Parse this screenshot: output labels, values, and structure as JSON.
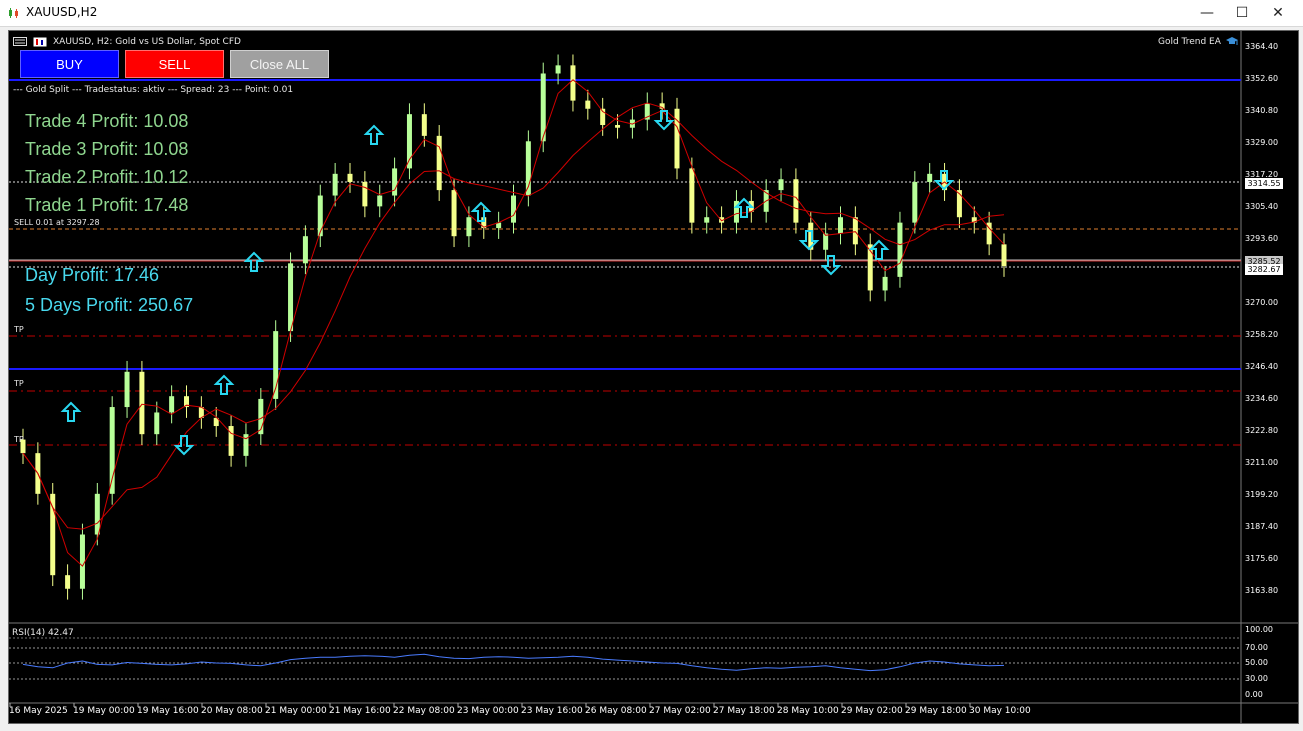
{
  "window": {
    "title": "XAUUSD,H2",
    "minimize": "—",
    "maximize": "☐",
    "close": "✕"
  },
  "chart_header": "XAUUSD, H2:  Gold vs US Dollar, Spot CFD",
  "ea_name": "Gold Trend EA",
  "buttons": {
    "buy": "BUY",
    "sell": "SELL",
    "close_all": "Close ALL"
  },
  "status_line": "--- Gold Split --- Tradestatus: aktiv --- Spread: 23 --- Point: 0.01",
  "trades": [
    "Trade 4 Profit: 10.08",
    "Trade 3 Profit: 10.08",
    "Trade 2 Profit: 10.12",
    "Trade 1 Profit: 17.48"
  ],
  "position_label": "SELL 0.01 at 3297.28",
  "day_profit": "Day Profit: 17.46",
  "five_day_profit": "5 Days Profit: 250.67",
  "tp_labels": [
    "TP",
    "TP",
    "TP"
  ],
  "price_axis": [
    "3364.40",
    "3352.60",
    "3340.80",
    "3329.00",
    "3317.20",
    "3305.40",
    "3293.60",
    "3282.67",
    "3270.00",
    "3258.20",
    "3246.40",
    "3234.60",
    "3222.80",
    "3211.00",
    "3199.20",
    "3187.40",
    "3175.60",
    "3163.80"
  ],
  "price_tags": {
    "level_1": "3314.55",
    "level_2": "3285.52",
    "last": "3282.67"
  },
  "rsi": {
    "label": "RSI(14) 42.47",
    "axis": [
      "100.00",
      "70.00",
      "50.00",
      "30.00",
      "0.00"
    ]
  },
  "time_axis": [
    "16 May 2025",
    "19 May 00:00",
    "19 May 16:00",
    "20 May 08:00",
    "21 May 00:00",
    "21 May 16:00",
    "22 May 08:00",
    "23 May 00:00",
    "23 May 16:00",
    "26 May 08:00",
    "27 May 02:00",
    "27 May 18:00",
    "28 May 10:00",
    "29 May 02:00",
    "29 May 18:00",
    "30 May 10:00"
  ],
  "colors": {
    "background": "#000000",
    "bull": "#b8ff9a",
    "bear": "#f4ff8c",
    "ma": "#d00000",
    "level_line": "#1a1aff",
    "tp_line": "#c00000",
    "rsi_line": "#4a7cff",
    "signal_arrow": "#29d7f0"
  }
}
